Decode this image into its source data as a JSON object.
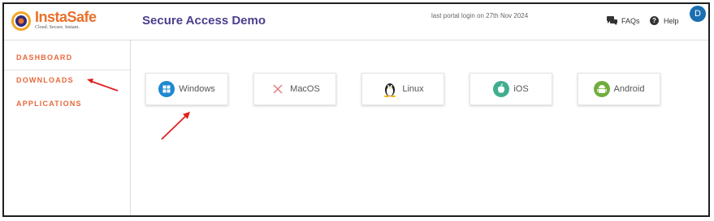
{
  "header": {
    "logo": {
      "brand": "InstaSafe",
      "tagline": "Cloud. Secure. Instant."
    },
    "app_title": "Secure Access Demo",
    "last_login": "last portal login on 27th Nov 2024",
    "faqs_label": "FAQs",
    "help_label": "Help",
    "user_initial": "D"
  },
  "sidebar": {
    "items": [
      {
        "label": "DASHBOARD"
      },
      {
        "label": "DOWNLOADS"
      },
      {
        "label": "APPLICATIONS"
      }
    ]
  },
  "downloads": {
    "platforms": [
      {
        "label": "Windows",
        "icon": "windows-icon",
        "color": "#1f88d0"
      },
      {
        "label": "MacOS",
        "icon": "macos-x-icon",
        "color": "#e07a7a"
      },
      {
        "label": "Linux",
        "icon": "linux-penguin-icon",
        "color": "#222222"
      },
      {
        "label": "iOS",
        "icon": "apple-icon",
        "color": "#3fae8f"
      },
      {
        "label": "Android",
        "icon": "android-icon",
        "color": "#6fae3c"
      }
    ]
  },
  "colors": {
    "accent": "#e8683a",
    "title": "#4a3f8c",
    "avatar": "#1a6fb0",
    "annotation_arrow": "#e02020"
  }
}
